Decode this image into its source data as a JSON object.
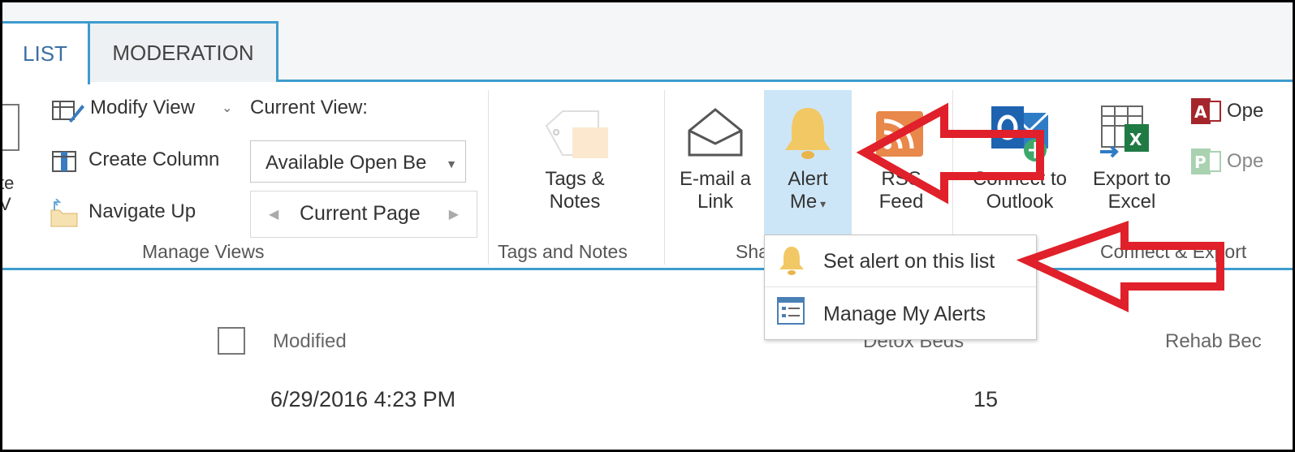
{
  "tabs": [
    {
      "label": "LIST"
    },
    {
      "label": "MODERATION"
    }
  ],
  "ribbon": {
    "manage_views": {
      "group_label": "Manage Views",
      "cut_left_top": "te",
      "cut_left_bottom": "V",
      "modify_view": "Modify View",
      "create_column": "Create Column",
      "navigate_up": "Navigate Up",
      "current_view_label": "Current View:",
      "current_view_value": "Available Open Be",
      "pager_label": "Current Page"
    },
    "tags_notes": {
      "group_label": "Tags and Notes",
      "button_line1": "Tags &",
      "button_line2": "Notes"
    },
    "share_track": {
      "group_label": "Sha",
      "email_line1": "E-mail a",
      "email_line2": "Link",
      "alert_line1": "Alert",
      "alert_line2": "Me",
      "rss_line1": "RSS",
      "rss_line2": "Feed"
    },
    "connect_export": {
      "group_label": "Connect & Export",
      "outlook_line1": "Connect to",
      "outlook_line2": "Outlook",
      "excel_line1": "Export to",
      "excel_line2": "Excel",
      "access_label": "Ope",
      "project_label": "Ope"
    }
  },
  "alert_menu": {
    "items": [
      {
        "label": "Set alert on this list",
        "icon": "bell-icon"
      },
      {
        "label": "Manage My Alerts",
        "icon": "alerts-list-icon"
      }
    ]
  },
  "list": {
    "columns": [
      "Modified",
      "Detox Beds",
      "Rehab Bec"
    ],
    "rows": [
      {
        "modified": "6/29/2016 4:23 PM",
        "detox_beds": "15"
      }
    ]
  },
  "colors": {
    "accent": "#3e9ccd",
    "annotation": "#e0202a",
    "highlight": "#cde6f7"
  }
}
